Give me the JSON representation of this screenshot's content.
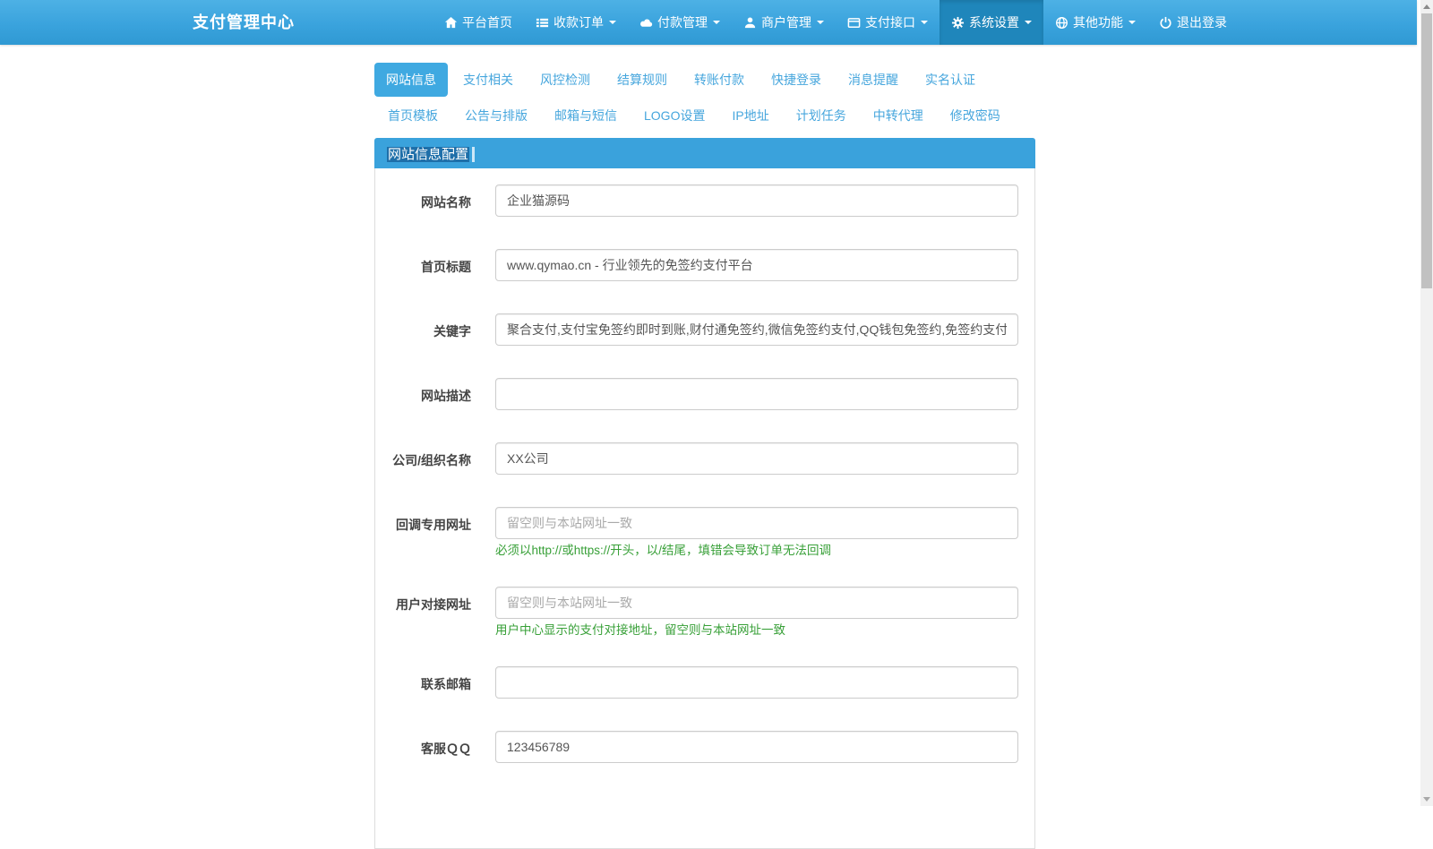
{
  "navbar": {
    "brand": "支付管理中心",
    "items": [
      {
        "label": "平台首页",
        "icon": "home-icon",
        "caret": false,
        "active": false
      },
      {
        "label": "收款订单",
        "icon": "list-icon",
        "caret": true,
        "active": false
      },
      {
        "label": "付款管理",
        "icon": "cloud-icon",
        "caret": true,
        "active": false
      },
      {
        "label": "商户管理",
        "icon": "user-icon",
        "caret": true,
        "active": false
      },
      {
        "label": "支付接口",
        "icon": "card-icon",
        "caret": true,
        "active": false
      },
      {
        "label": "系统设置",
        "icon": "gear-icon",
        "caret": true,
        "active": true
      },
      {
        "label": "其他功能",
        "icon": "globe-icon",
        "caret": true,
        "active": false
      },
      {
        "label": "退出登录",
        "icon": "power-icon",
        "caret": false,
        "active": false
      }
    ]
  },
  "tabs_row1": [
    {
      "label": "网站信息",
      "active": true
    },
    {
      "label": "支付相关",
      "active": false
    },
    {
      "label": "风控检测",
      "active": false
    },
    {
      "label": "结算规则",
      "active": false
    },
    {
      "label": "转账付款",
      "active": false
    },
    {
      "label": "快捷登录",
      "active": false
    },
    {
      "label": "消息提醒",
      "active": false
    },
    {
      "label": "实名认证",
      "active": false
    }
  ],
  "tabs_row2": [
    {
      "label": "首页模板"
    },
    {
      "label": "公告与排版"
    },
    {
      "label": "邮箱与短信"
    },
    {
      "label": "LOGO设置"
    },
    {
      "label": "IP地址"
    },
    {
      "label": "计划任务"
    },
    {
      "label": "中转代理"
    },
    {
      "label": "修改密码"
    }
  ],
  "panel": {
    "title": "网站信息配置"
  },
  "form": {
    "fields": [
      {
        "label": "网站名称",
        "value": "企业猫源码",
        "placeholder": "",
        "helper": ""
      },
      {
        "label": "首页标题",
        "value": "www.qymao.cn - 行业领先的免签约支付平台",
        "placeholder": "",
        "helper": ""
      },
      {
        "label": "关键字",
        "value": "聚合支付,支付宝免签约即时到账,财付通免签约,微信免签约支付,QQ钱包免签约,免签约支付",
        "placeholder": "",
        "helper": ""
      },
      {
        "label": "网站描述",
        "value": "",
        "placeholder": "",
        "helper": ""
      },
      {
        "label": "公司/组织名称",
        "value": "XX公司",
        "placeholder": "",
        "helper": ""
      },
      {
        "label": "回调专用网址",
        "value": "",
        "placeholder": "留空则与本站网址一致",
        "helper": "必须以http://或https://开头，以/结尾，填错会导致订单无法回调"
      },
      {
        "label": "用户对接网址",
        "value": "",
        "placeholder": "留空则与本站网址一致",
        "helper": "用户中心显示的支付对接地址，留空则与本站网址一致"
      },
      {
        "label": "联系邮箱",
        "value": "",
        "placeholder": "",
        "helper": ""
      },
      {
        "label": "客服ＱＱ",
        "value": "123456789",
        "placeholder": "",
        "helper": ""
      }
    ]
  },
  "colors": {
    "navbar_blue": "#3aa3dd",
    "nav_active": "#1f86bb",
    "tab_active": "#3fa9e1",
    "tab_link": "#46a6dd",
    "panel_header": "#3aa2dc",
    "title_selection": "#1e6fa9",
    "helper_green": "#38a038",
    "input_border": "#cccccc",
    "panel_border": "#dddddd"
  }
}
